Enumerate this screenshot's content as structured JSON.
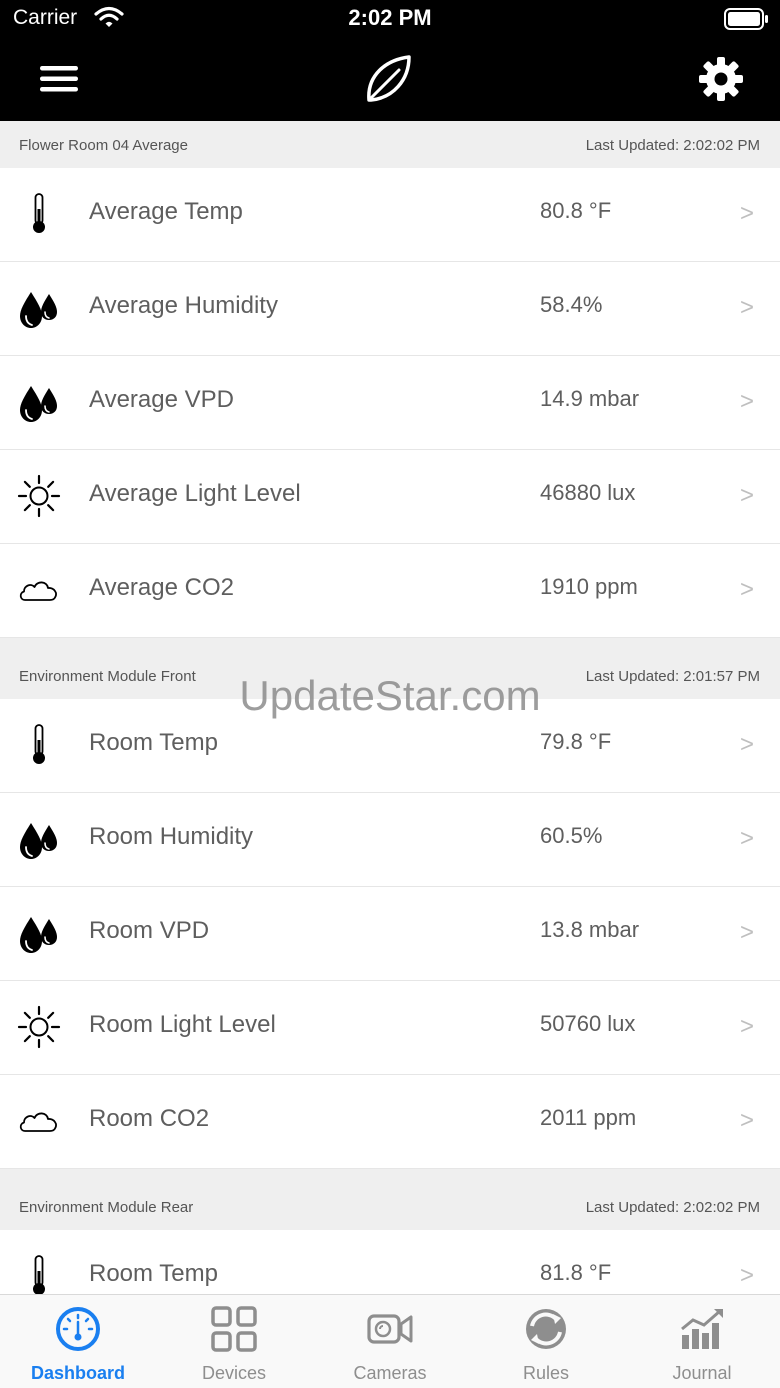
{
  "status_bar": {
    "carrier": "Carrier",
    "time": "2:02 PM"
  },
  "sections": [
    {
      "title": "Flower Room 04 Average",
      "updated": "Last Updated: 2:02:02 PM",
      "rows": [
        {
          "icon": "thermometer-icon",
          "label": "Average Temp",
          "value": "80.8 °F",
          "chevron": ">"
        },
        {
          "icon": "droplets-icon",
          "label": "Average Humidity",
          "value": "58.4%",
          "chevron": ">"
        },
        {
          "icon": "droplets-icon",
          "label": "Average VPD",
          "value": "14.9 mbar",
          "chevron": ">"
        },
        {
          "icon": "sun-icon",
          "label": "Average Light Level",
          "value": "46880 lux",
          "chevron": ">"
        },
        {
          "icon": "cloud-icon",
          "label": "Average CO2",
          "value": "1910 ppm",
          "chevron": ">"
        }
      ]
    },
    {
      "title": "Environment Module Front",
      "updated": "Last Updated: 2:01:57 PM",
      "rows": [
        {
          "icon": "thermometer-icon",
          "label": "Room Temp",
          "value": "79.8 °F",
          "chevron": ">"
        },
        {
          "icon": "droplets-icon",
          "label": "Room Humidity",
          "value": "60.5%",
          "chevron": ">"
        },
        {
          "icon": "droplets-icon",
          "label": "Room VPD",
          "value": "13.8 mbar",
          "chevron": ">"
        },
        {
          "icon": "sun-icon",
          "label": "Room Light Level",
          "value": "50760 lux",
          "chevron": ">"
        },
        {
          "icon": "cloud-icon",
          "label": "Room CO2",
          "value": "2011 ppm",
          "chevron": ">"
        }
      ]
    },
    {
      "title": "Environment Module Rear",
      "updated": "Last Updated: 2:02:02 PM",
      "rows": [
        {
          "icon": "thermometer-icon",
          "label": "Room Temp",
          "value": "81.8 °F",
          "chevron": ">"
        }
      ]
    }
  ],
  "watermark": "UpdateStar.com",
  "tabs": [
    {
      "label": "Dashboard",
      "icon": "gauge-icon",
      "active": true
    },
    {
      "label": "Devices",
      "icon": "grid-icon",
      "active": false
    },
    {
      "label": "Cameras",
      "icon": "camera-icon",
      "active": false
    },
    {
      "label": "Rules",
      "icon": "cycle-icon",
      "active": false
    },
    {
      "label": "Journal",
      "icon": "chart-icon",
      "active": false
    }
  ],
  "colors": {
    "accent": "#1a7ff0",
    "header_bg": "#000000",
    "inactive_tab": "#8e8e8e"
  }
}
